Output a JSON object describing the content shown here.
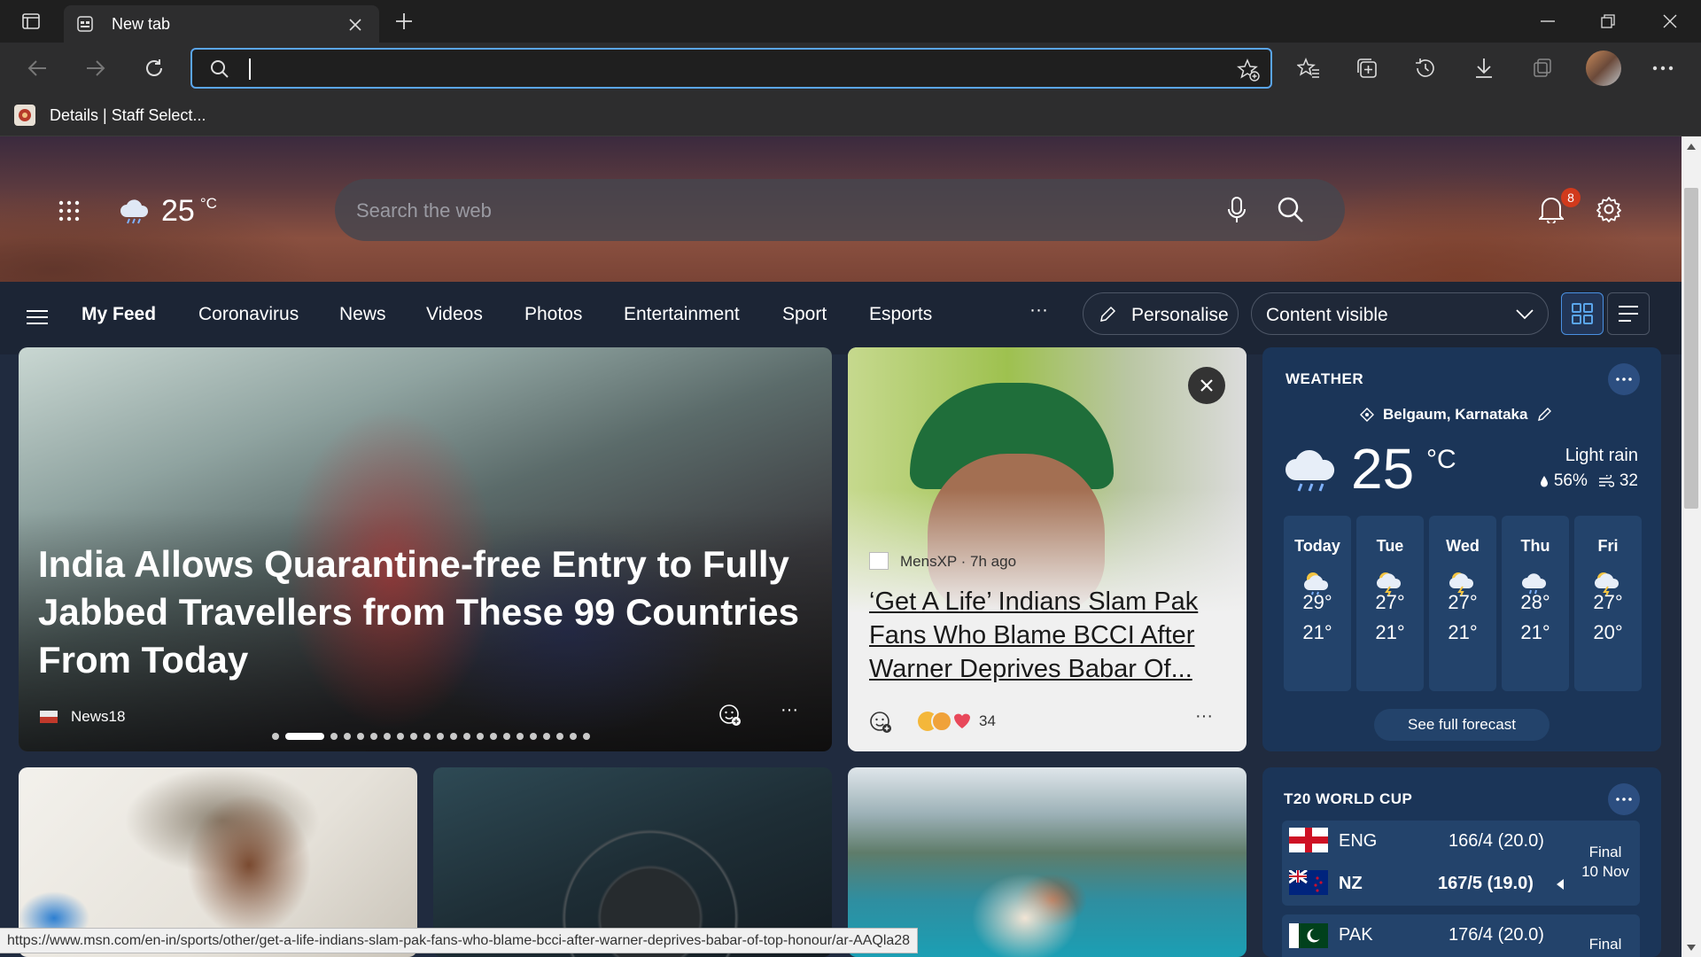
{
  "browser": {
    "tab_title": "New tab",
    "address_value": "",
    "favorite": "Details | Staff Select...",
    "status_url": "https://www.msn.com/en-in/sports/other/get-a-life-indians-slam-pak-fans-who-blame-bcci-after-warner-deprives-babar-of-top-honour/ar-AAQla28"
  },
  "header": {
    "temp": "25",
    "unit": "°C",
    "search_placeholder": "Search the web",
    "notification_count": "8"
  },
  "nav": {
    "items": [
      "My Feed",
      "Coronavirus",
      "News",
      "Videos",
      "Photos",
      "Entertainment",
      "Sport",
      "Esports"
    ],
    "more": "···",
    "personalise": "Personalise",
    "content_visible": "Content visible"
  },
  "hero_story": {
    "headline": "India Allows Quarantine-free Entry to Fully Jabbed Travellers from These 99 Countries From Today",
    "source": "News18",
    "more": "···"
  },
  "story2": {
    "source": "MensXP · 7h ago",
    "headline": "‘Get A Life’ Indians Slam Pak Fans Who Blame BCCI After Warner Deprives Babar Of...",
    "reactions": "34",
    "more": "···"
  },
  "weather": {
    "title": "WEATHER",
    "location": "Belgaum, Karnataka",
    "temp": "25",
    "unit": "°C",
    "condition": "Light rain",
    "humidity": "56%",
    "wind": "32",
    "days": [
      {
        "day": "Today",
        "hi": "29°",
        "lo": "21°"
      },
      {
        "day": "Tue",
        "hi": "27°",
        "lo": "21°"
      },
      {
        "day": "Wed",
        "hi": "27°",
        "lo": "21°"
      },
      {
        "day": "Thu",
        "hi": "28°",
        "lo": "21°"
      },
      {
        "day": "Fri",
        "hi": "27°",
        "lo": "20°"
      }
    ],
    "forecast_link": "See full forecast"
  },
  "cricket": {
    "title": "T20 WORLD CUP",
    "match1": {
      "team1": "ENG",
      "score1": "166/4 (20.0)",
      "team2": "NZ",
      "score2": "167/5 (19.0)",
      "status": "Final",
      "date": "10 Nov"
    },
    "match2": {
      "team1": "PAK",
      "score1": "176/4 (20.0)",
      "status": "Final"
    }
  }
}
